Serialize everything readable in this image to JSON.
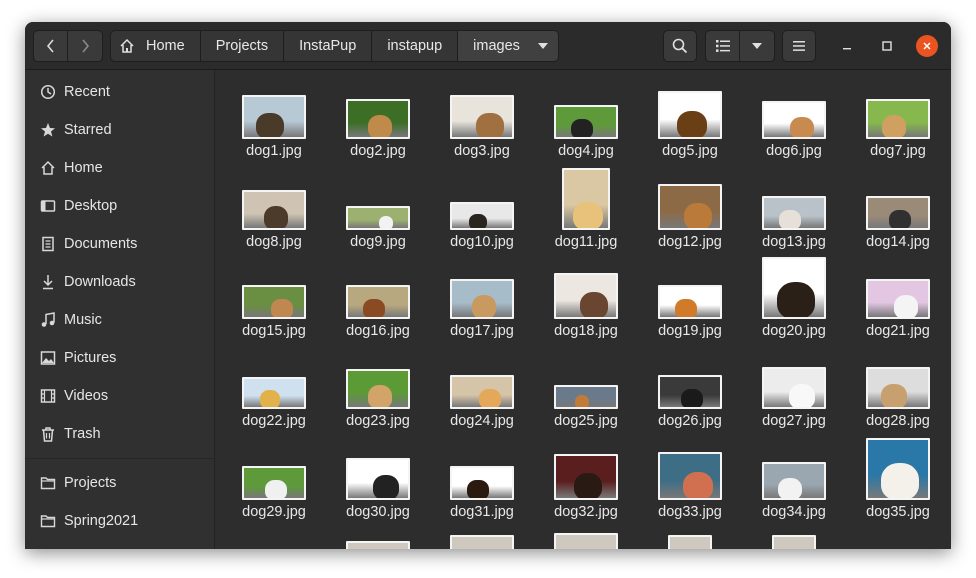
{
  "window": {
    "nav": {
      "back_icon": "chevron-left-icon",
      "forward_icon": "chevron-right-icon"
    },
    "path": [
      {
        "label": "Home",
        "icon": "home-icon"
      },
      {
        "label": "Projects"
      },
      {
        "label": "InstaPup"
      },
      {
        "label": "instapup"
      },
      {
        "label": "images",
        "current": true
      }
    ],
    "tools": {
      "search_icon": "search-icon",
      "view_icon": "list-view-icon",
      "menu_icon": "hamburger-menu-icon"
    }
  },
  "sidebar": {
    "items": [
      {
        "label": "Recent",
        "icon": "clock-icon"
      },
      {
        "label": "Starred",
        "icon": "star-icon"
      },
      {
        "label": "Home",
        "icon": "home-icon"
      },
      {
        "label": "Desktop",
        "icon": "desktop-icon"
      },
      {
        "label": "Documents",
        "icon": "document-icon"
      },
      {
        "label": "Downloads",
        "icon": "download-icon"
      },
      {
        "label": "Music",
        "icon": "music-icon"
      },
      {
        "label": "Pictures",
        "icon": "picture-icon"
      },
      {
        "label": "Videos",
        "icon": "video-icon"
      },
      {
        "label": "Trash",
        "icon": "trash-icon"
      }
    ],
    "bookmarks": [
      {
        "label": "Projects",
        "icon": "folder-icon"
      },
      {
        "label": "Spring2021",
        "icon": "folder-icon"
      }
    ]
  },
  "files": [
    "dog1.jpg",
    "dog2.jpg",
    "dog3.jpg",
    "dog4.jpg",
    "dog5.jpg",
    "dog6.jpg",
    "dog7.jpg",
    "dog8.jpg",
    "dog9.jpg",
    "dog10.jpg",
    "dog11.jpg",
    "dog12.jpg",
    "dog13.jpg",
    "dog14.jpg",
    "dog15.jpg",
    "dog16.jpg",
    "dog17.jpg",
    "dog18.jpg",
    "dog19.jpg",
    "dog20.jpg",
    "dog21.jpg",
    "dog22.jpg",
    "dog23.jpg",
    "dog24.jpg",
    "dog25.jpg",
    "dog26.jpg",
    "dog27.jpg",
    "dog28.jpg",
    "dog29.jpg",
    "dog30.jpg",
    "dog31.jpg",
    "dog32.jpg",
    "dog33.jpg",
    "dog34.jpg",
    "dog35.jpg"
  ],
  "colors": {
    "accent": "#e95420",
    "window_bg": "#2d2d2d",
    "sidebar_bg": "#303030"
  }
}
